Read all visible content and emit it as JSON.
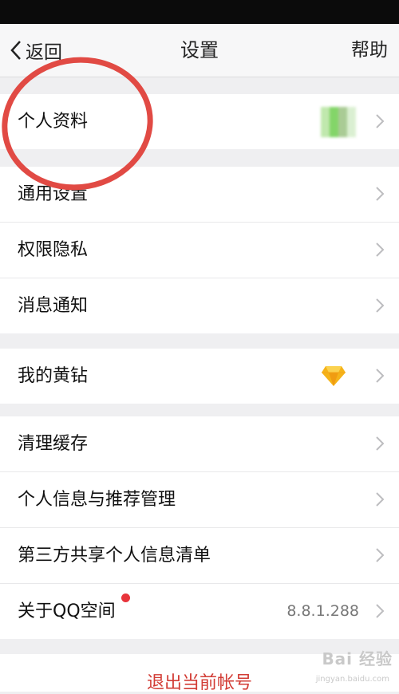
{
  "nav": {
    "back_label": "返回",
    "title": "设置",
    "help_label": "帮助"
  },
  "groups": [
    {
      "items": [
        {
          "label": "个人资料"
        }
      ]
    },
    {
      "items": [
        {
          "label": "通用设置"
        },
        {
          "label": "权限隐私"
        },
        {
          "label": "消息通知"
        }
      ]
    },
    {
      "items": [
        {
          "label": "我的黄钻",
          "icon": "yellow-diamond-icon"
        }
      ]
    },
    {
      "items": [
        {
          "label": "清理缓存"
        },
        {
          "label": "个人信息与推荐管理"
        },
        {
          "label": "第三方共享个人信息清单"
        },
        {
          "label": "关于QQ空间",
          "value": "8.8.1.288",
          "badge": "red-dot"
        }
      ]
    }
  ],
  "logout_label": "退出当前帐号",
  "watermark": {
    "text": "Bai 经验",
    "sub": "jingyan.baidu.com"
  },
  "colors": {
    "accent_red": "#d23c35",
    "annotation_circle": "#e14a44",
    "background": "#efeff1"
  }
}
